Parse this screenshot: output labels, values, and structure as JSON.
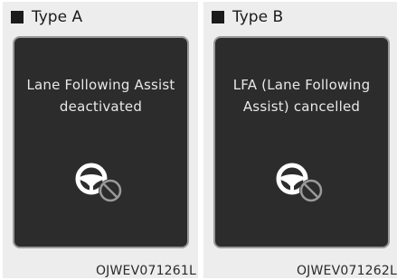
{
  "panels": [
    {
      "type_label": "Type A",
      "message_line1": "Lane Following Assist",
      "message_line2": "deactivated",
      "icon": "steering-wheel-disabled-icon",
      "code": "OJWEV071261L"
    },
    {
      "type_label": "Type B",
      "message_line1": "LFA (Lane Following",
      "message_line2": "Assist) cancelled",
      "icon": "steering-wheel-disabled-icon",
      "code": "OJWEV071262L"
    }
  ],
  "colors": {
    "panel_bg": "#ededed",
    "screen_bg": "#2c2c2c",
    "screen_border": "#9a9a9a",
    "message_text": "#e8e8e8"
  }
}
